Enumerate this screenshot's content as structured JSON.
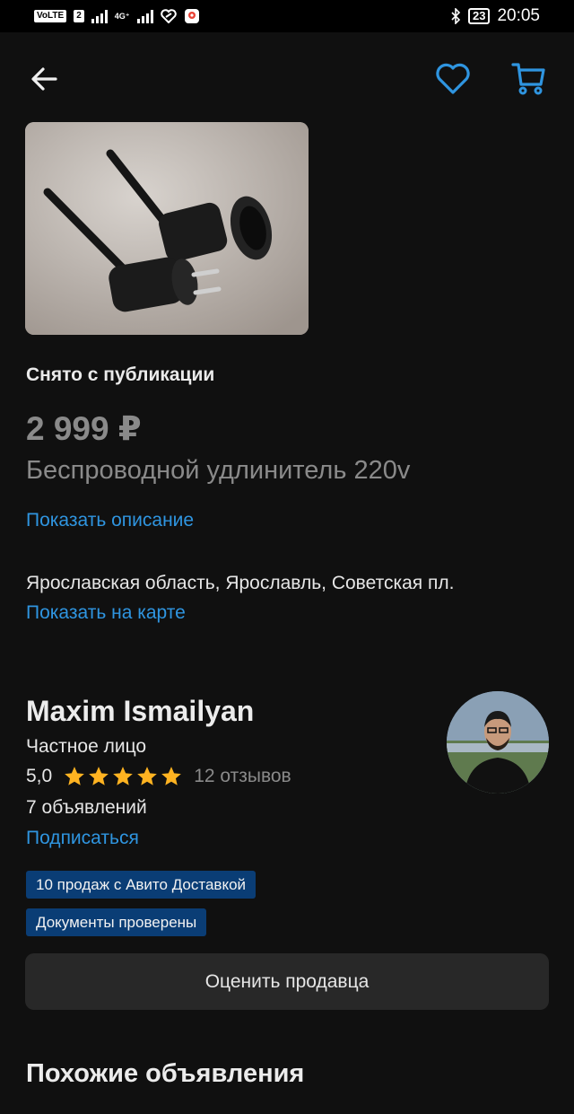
{
  "status_bar": {
    "volte": "VoLTE",
    "sim": "2",
    "network": "4G⁺",
    "battery": "23",
    "time": "20:05"
  },
  "top_bar": {
    "icons": [
      "back-arrow-icon",
      "heart-icon",
      "cart-icon"
    ],
    "accent_color": "#2f95e0"
  },
  "listing": {
    "status": "Снято с публикации",
    "price": "2 999 ₽",
    "title": "Беспроводной удлинитель 220v",
    "show_description": "Показать описание",
    "address": "Ярославская область, Ярославль, Советская пл.",
    "show_on_map": "Показать на карте"
  },
  "seller": {
    "name": "Maxim Ismailyan",
    "type": "Частное лицо",
    "rating": "5,0",
    "rating_stars": 5,
    "reviews": "12 отзывов",
    "ads_count": "7 объявлений",
    "subscribe": "Подписаться",
    "badges": [
      "10 продаж с Авито Доставкой",
      "Документы проверены"
    ],
    "rate_button": "Оценить продавца"
  },
  "similar": {
    "heading": "Похожие объявления"
  }
}
